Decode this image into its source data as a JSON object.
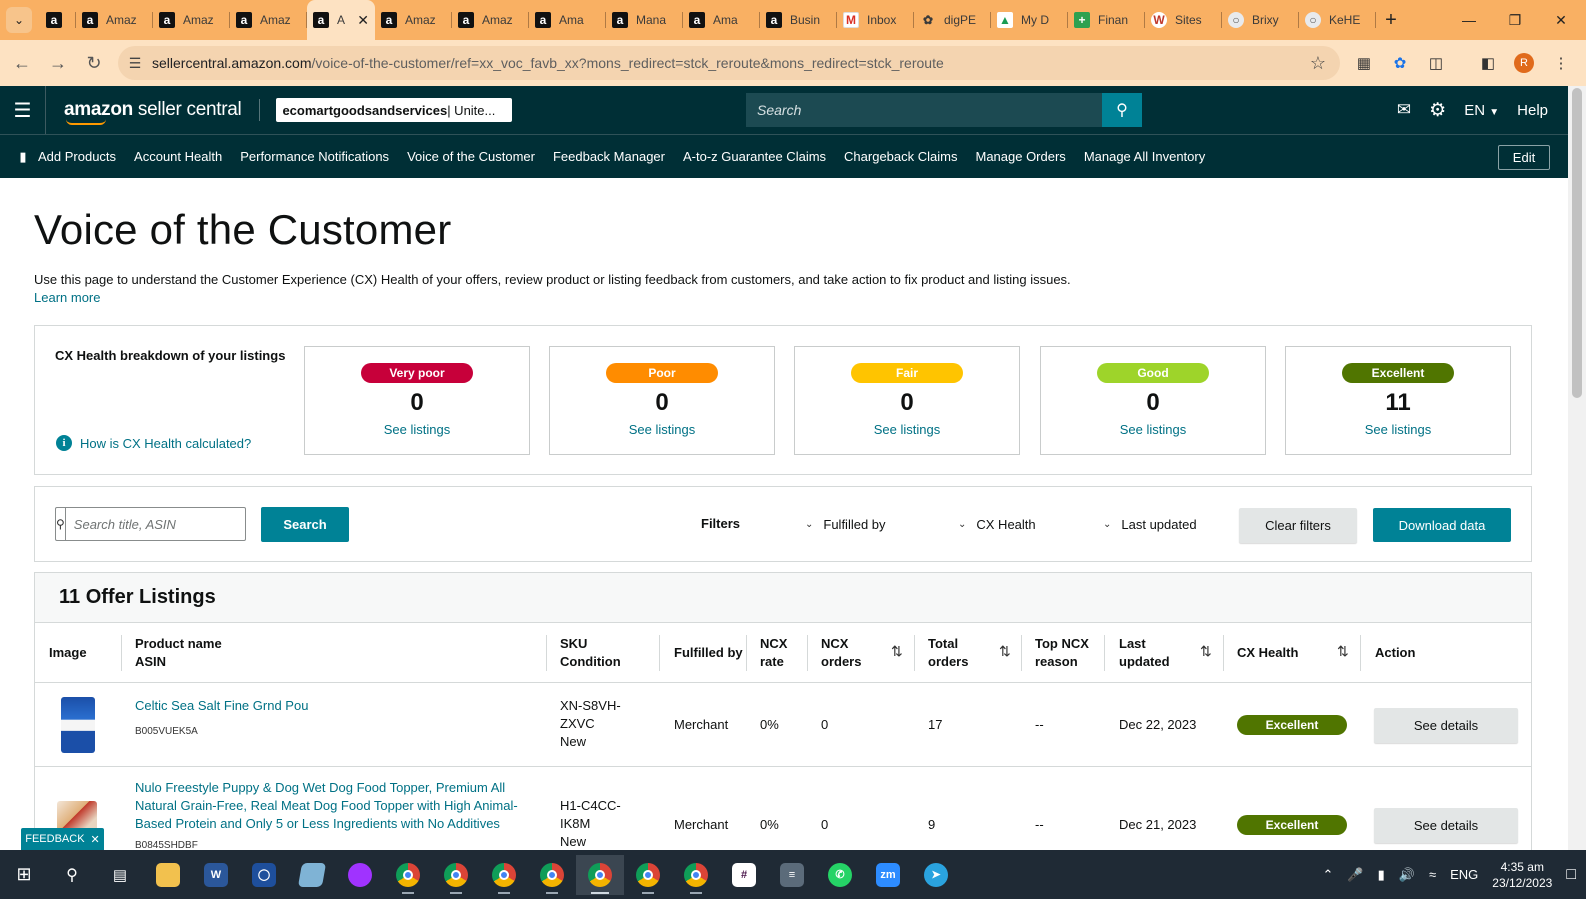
{
  "browser": {
    "tabs": [
      {
        "title": "",
        "icon": "amazon"
      },
      {
        "title": "Amaz",
        "icon": "amazon"
      },
      {
        "title": "Amaz",
        "icon": "amazon"
      },
      {
        "title": "Amaz",
        "icon": "amazon"
      },
      {
        "title": "A",
        "icon": "amazon",
        "active": true
      },
      {
        "title": "Amaz",
        "icon": "amazon"
      },
      {
        "title": "Amaz",
        "icon": "amazon"
      },
      {
        "title": "Ama",
        "icon": "amazon"
      },
      {
        "title": "Mana",
        "icon": "amazon"
      },
      {
        "title": "Ama",
        "icon": "amazon"
      },
      {
        "title": "Busin",
        "icon": "amazon"
      },
      {
        "title": "Inbox",
        "icon": "gmail"
      },
      {
        "title": "digPE",
        "icon": "paw"
      },
      {
        "title": "My D",
        "icon": "drive"
      },
      {
        "title": "Finan",
        "icon": "sheets"
      },
      {
        "title": "Sites",
        "icon": "wordpress"
      },
      {
        "title": "Brixy",
        "icon": "globe"
      },
      {
        "title": "KeHE",
        "icon": "globe"
      }
    ],
    "url_host": "sellercentral.amazon.com",
    "url_path": "/voice-of-the-customer/ref=xx_voc_favb_xx?mons_redirect=stck_reroute&mons_redirect=stck_reroute",
    "profile_initial": "R"
  },
  "header": {
    "logo_bold": "amazon",
    "logo_rest": " seller central",
    "store_name": "ecomartgoodsandservices",
    "store_region": " | Unite...",
    "search_placeholder": "Search",
    "language": "EN",
    "help": "Help"
  },
  "nav": {
    "items": [
      "Add Products",
      "Account Health",
      "Performance Notifications",
      "Voice of the Customer",
      "Feedback Manager",
      "A-to-z Guarantee Claims",
      "Chargeback Claims",
      "Manage Orders",
      "Manage All Inventory"
    ],
    "edit": "Edit"
  },
  "page": {
    "title": "Voice of the Customer",
    "description": "Use this page to understand the Customer Experience (CX) Health of your offers, review product or listing feedback from customers, and take action to fix product and listing issues.",
    "learn_more": "Learn more"
  },
  "cx": {
    "title": "CX Health breakdown of your listings",
    "help_link": "How is CX Health calculated?",
    "cards": [
      {
        "label": "Very poor",
        "count": "0",
        "link": "See listings",
        "color": "#c7003a"
      },
      {
        "label": "Poor",
        "count": "0",
        "link": "See listings",
        "color": "#ff8c00"
      },
      {
        "label": "Fair",
        "count": "0",
        "link": "See listings",
        "color": "#ffc400"
      },
      {
        "label": "Good",
        "count": "0",
        "link": "See listings",
        "color": "#9ed42a"
      },
      {
        "label": "Excellent",
        "count": "11",
        "link": "See listings",
        "color": "#507500"
      }
    ]
  },
  "filters": {
    "search_placeholder": "Search title, ASIN",
    "search_button": "Search",
    "label": "Filters",
    "dropdowns": [
      "Fulfilled by",
      "CX Health",
      "Last updated"
    ],
    "clear": "Clear filters",
    "download": "Download data"
  },
  "listings": {
    "heading": "11 Offer Listings",
    "columns": {
      "image": "Image",
      "product_name": "Product name",
      "asin": "ASIN",
      "sku": "SKU",
      "condition": "Condition",
      "fulfilled_by": "Fulfilled by",
      "ncx_rate_1": "NCX",
      "ncx_rate_2": "rate",
      "ncx_orders_1": "NCX",
      "ncx_orders_2": "orders",
      "total_orders_1": "Total",
      "total_orders_2": "orders",
      "top_ncx_1": "Top NCX",
      "top_ncx_2": "reason",
      "last_updated_1": "Last",
      "last_updated_2": "updated",
      "cx_health": "CX Health",
      "action": "Action"
    },
    "rows": [
      {
        "name": "Celtic Sea Salt Fine Grnd Pou",
        "asin": "B005VUEK5A",
        "sku_1": "XN-S8VH-",
        "sku_2": "ZXVC",
        "condition": "New",
        "fulfilled_by": "Merchant",
        "ncx_rate": "0%",
        "ncx_orders": "0",
        "total_orders": "17",
        "top_ncx": "--",
        "last_updated": "Dec 22, 2023",
        "cx_health": "Excellent",
        "action": "See details"
      },
      {
        "name": "Nulo Freestyle Puppy & Dog Wet Dog Food Topper, Premium All Natural Grain-Free, Real Meat Dog Food Topper with High Animal-Based Protein and Only 5 or Less Ingredients with No Additives",
        "asin": "B0845SHDBF",
        "sku_1": "H1-C4CC-",
        "sku_2": "IK8M",
        "condition": "New",
        "fulfilled_by": "Merchant",
        "ncx_rate": "0%",
        "ncx_orders": "0",
        "total_orders": "9",
        "top_ncx": "--",
        "last_updated": "Dec 21, 2023",
        "cx_health": "Excellent",
        "action": "See details"
      }
    ]
  },
  "feedback": "FEEDBACK",
  "taskbar": {
    "language": "ENG",
    "time": "4:35 am",
    "date": "23/12/2023"
  }
}
